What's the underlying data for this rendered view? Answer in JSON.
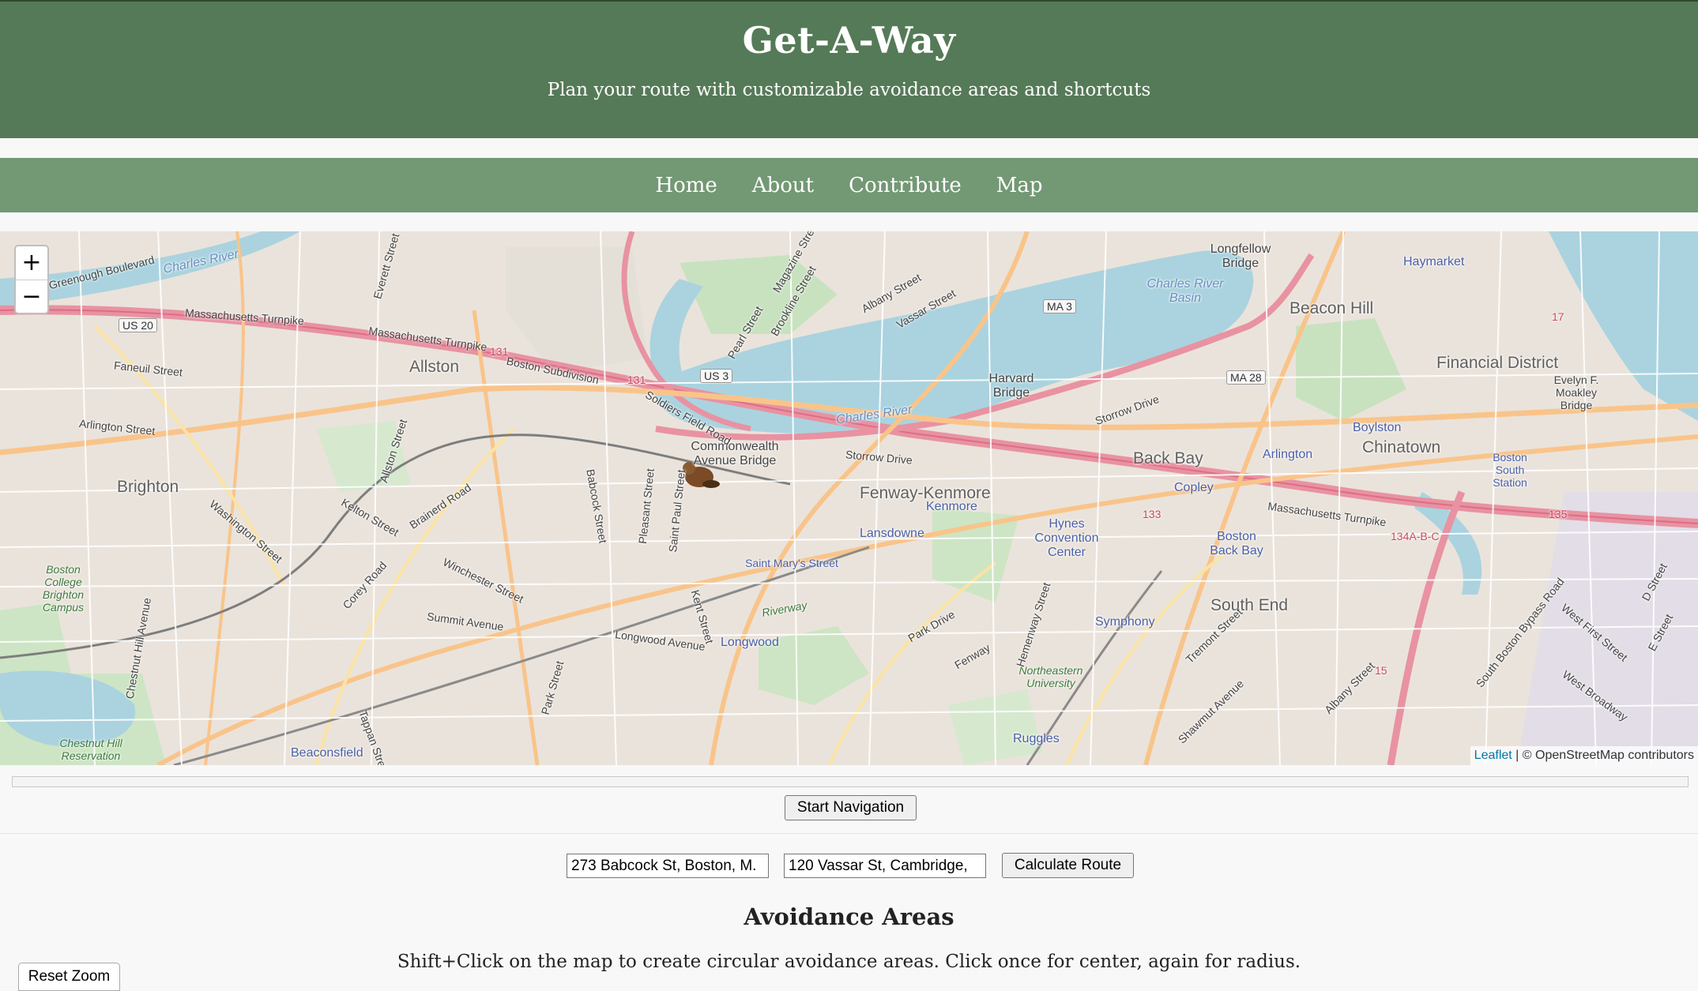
{
  "header": {
    "title": "Get-A-Way",
    "subtitle": "Plan your route with customizable avoidance areas and shortcuts"
  },
  "nav": {
    "items": [
      {
        "label": "Home"
      },
      {
        "label": "About"
      },
      {
        "label": "Contribute"
      },
      {
        "label": "Map"
      }
    ]
  },
  "map": {
    "zoom_in": "+",
    "zoom_out": "−",
    "attribution_link": "Leaflet",
    "attribution_text": " | © OpenStreetMap contributors",
    "labels": {
      "allston": "Allston",
      "brighton": "Brighton",
      "back_bay": "Back Bay",
      "beacon_hill": "Beacon Hill",
      "financial_district": "Financial District",
      "chinatown": "Chinatown",
      "south_end": "South End",
      "fenway_kenmore": "Fenway-Kenmore",
      "haymarket": "Haymarket",
      "kenmore": "Kenmore",
      "lansdowne": "Lansdowne",
      "copley": "Copley",
      "arlington": "Arlington",
      "boylston": "Boylston",
      "symphony": "Symphony",
      "longwood": "Longwood",
      "ruggles": "Ruggles",
      "beaconsfield": "Beaconsfield",
      "hynes": "Hynes Convention Center",
      "back_bay_station": "Boston Back Bay",
      "south_station": "Boston South Station",
      "harvard_bridge": "Harvard Bridge",
      "longfellow_bridge": "Longfellow Bridge",
      "commonwealth_bridge": "Commonwealth Avenue Bridge",
      "moakley_bridge": "Evelyn F. Moakley Bridge",
      "saint_marys": "Saint Mary's Street",
      "charles_river_basin": "Charles River Basin",
      "charles_river": "Charles River",
      "charles_river_nw": "Charles River",
      "bc_campus": "Boston College Brighton Campus",
      "chestnut_hill": "Chestnut Hill Reservation",
      "northeastern": "Northeastern University",
      "mass_pike_w": "Massachusetts Turnpike",
      "mass_pike_mid": "Massachusetts Turnpike",
      "mass_pike_e": "Massachusetts Turnpike",
      "storrow_1": "Storrow Drive",
      "storrow_2": "Storrow Drive",
      "soldiers_field": "Soldiers Field Road",
      "boston_subdivision": "Boston Subdivision",
      "faneuil": "Faneuil Street",
      "arlington_st": "Arlington Street",
      "washington_st": "Washington Street",
      "kelton_st": "Kelton Street",
      "brainerd_rd": "Brainerd Road",
      "corey_rd": "Corey Road",
      "winchester_st": "Winchester Street",
      "summit_ave": "Summit Avenue",
      "chestnut_hill_ave": "Chestnut Hill Avenue",
      "babcock_st": "Babcock Street",
      "pleasant_st": "Pleasant Street",
      "saint_paul_st": "Saint Paul Street",
      "kent_st": "Kent Street",
      "longwood_ave": "Longwood Avenue",
      "park_st": "Park Street",
      "park_drive": "Park Drive",
      "fenway": "Fenway",
      "riverway": "Riverway",
      "hemenway": "Hemenway Street",
      "tremont": "Tremont Street",
      "shawmut": "Shawmut Avenue",
      "albany_st": "Albany Street",
      "south_boston_bypass": "South Boston Bypass Road",
      "west_first": "West First Street",
      "west_broadway": "West Broadway",
      "d_street": "D Street",
      "e_street": "E Street",
      "greenough": "Greenough Boulevard",
      "everett": "Everett Street",
      "allston_st": "Allston Street",
      "brookline_st": "Brookline Street",
      "vassar_st": "Vassar Street",
      "albany_st_n": "Albany Street",
      "pearl_st": "Pearl Street",
      "magazine_st": "Magazine Street",
      "tappan": "Tappan Street"
    },
    "shields": {
      "us20": "US 20",
      "us3": "US 3",
      "ma3": "MA 3",
      "ma28": "MA 28",
      "x131a": "131",
      "x131b": "131",
      "x133": "133",
      "x134": "134A-B-C",
      "x135": "135",
      "x15": "15",
      "x17": "17"
    }
  },
  "progress": 0,
  "controls": {
    "start_navigation": "Start Navigation",
    "origin_value": "273 Babcock St, Boston, M.",
    "destination_value": "120 Vassar St, Cambridge,",
    "calculate_route": "Calculate Route",
    "reset_zoom": "Reset Zoom"
  },
  "avoidance": {
    "title": "Avoidance Areas",
    "description": "Shift+Click on the map to create circular avoidance areas. Click once for center, again for radius."
  }
}
